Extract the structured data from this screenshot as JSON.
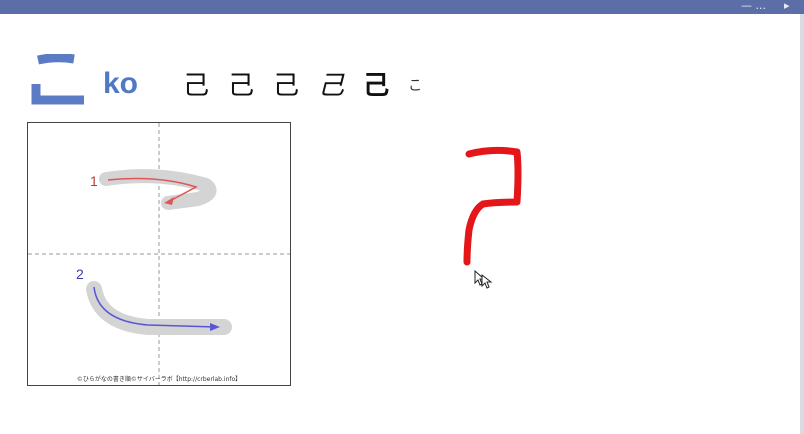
{
  "header": {
    "text": "— ...",
    "icon": "speaker-icon"
  },
  "lesson": {
    "kana": "こ",
    "romaji": "ko",
    "variants": [
      "己",
      "己",
      "己",
      "己",
      "己",
      "こ"
    ],
    "accent_color": "#5b7cc4"
  },
  "stroke_chart": {
    "stroke_numbers": [
      "1",
      "2"
    ],
    "stroke_colors": [
      "#e05555",
      "#5757d6"
    ],
    "credit": "©ひらがなの書き順©サイバーラボ【http://crberlab.info】"
  },
  "canvas": {
    "ink_color": "#e4161a",
    "cursor_icon": "arrow-cursor-icon"
  }
}
